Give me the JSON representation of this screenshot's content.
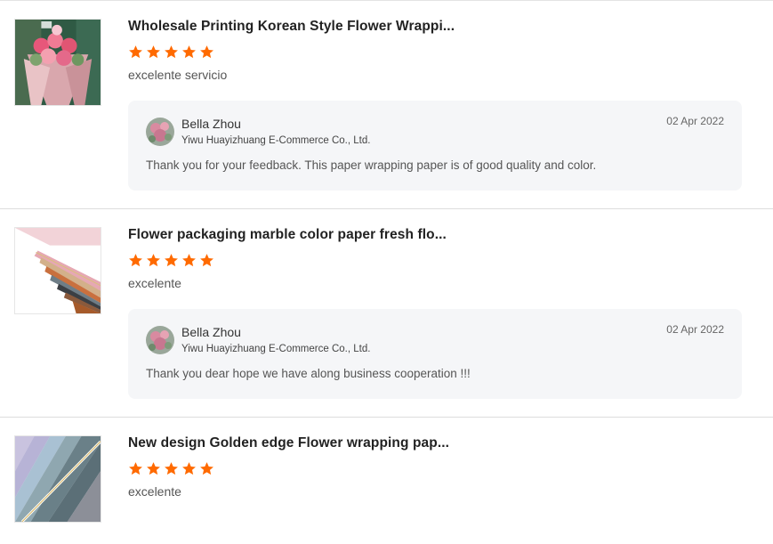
{
  "colors": {
    "star": "#ff6a00",
    "reply_background": "#f5f6f8",
    "divider": "#dddddd"
  },
  "reviews": [
    {
      "product_title": "Wholesale Printing Korean Style Flower Wrappi...",
      "rating": 5,
      "comment": "excelente servicio",
      "thumbnail_icon": "flower-bouquet-image",
      "reply": {
        "seller_name": "Bella Zhou",
        "company": "Yiwu Huayizhuang E-Commerce Co., Ltd.",
        "date": "02 Apr 2022",
        "text": "Thank you for your feedback. This paper wrapping paper is of good quality and color."
      }
    },
    {
      "product_title": "Flower packaging marble color paper fresh flo...",
      "rating": 5,
      "comment": "excelente",
      "thumbnail_icon": "wrapping-paper-stack-image",
      "reply": {
        "seller_name": "Bella Zhou",
        "company": "Yiwu Huayizhuang E-Commerce Co., Ltd.",
        "date": "02 Apr 2022",
        "text": "Thank you dear hope we have along business cooperation !!!"
      }
    },
    {
      "product_title": "New design Golden edge Flower wrapping pap...",
      "rating": 5,
      "comment": "excelente",
      "thumbnail_icon": "golden-edge-paper-image"
    }
  ]
}
